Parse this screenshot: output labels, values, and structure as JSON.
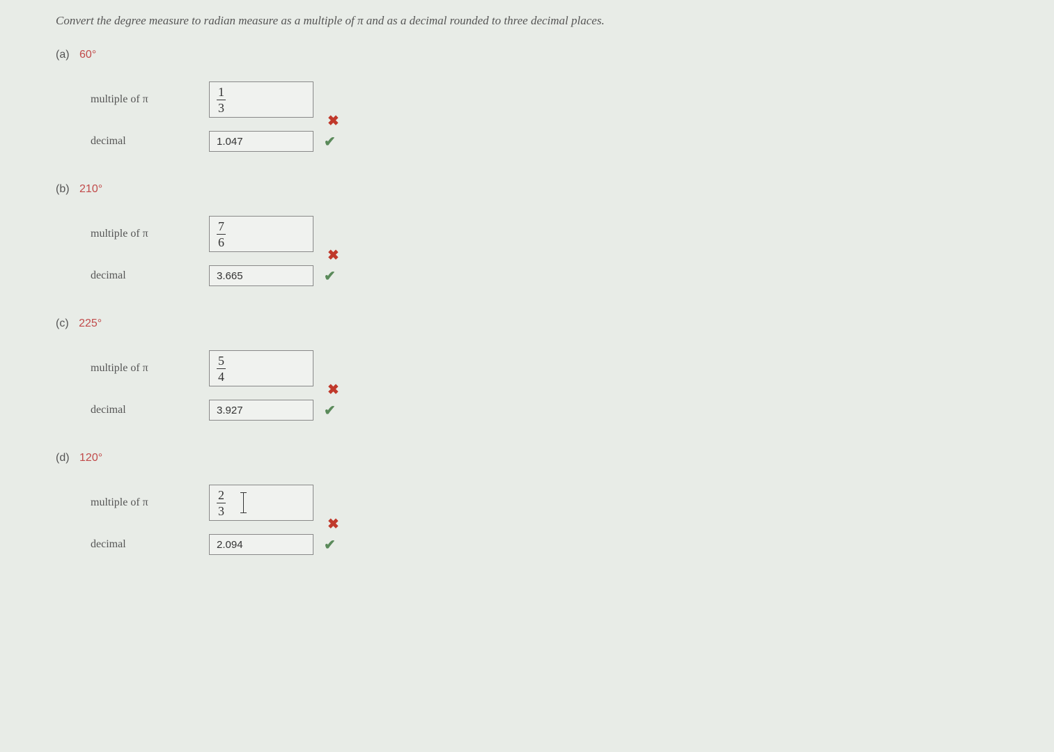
{
  "instruction": "Convert the degree measure to radian measure as a multiple of π and as a decimal rounded to three decimal places.",
  "labels": {
    "multiple": "multiple of π",
    "decimal": "decimal"
  },
  "parts": {
    "a": {
      "letter": "(a)",
      "degree": "60°",
      "frac_num": "1",
      "frac_den": "3",
      "decimal": "1.047"
    },
    "b": {
      "letter": "(b)",
      "degree": "210°",
      "frac_num": "7",
      "frac_den": "6",
      "decimal": "3.665"
    },
    "c": {
      "letter": "(c)",
      "degree": "225°",
      "frac_num": "5",
      "frac_den": "4",
      "decimal": "3.927"
    },
    "d": {
      "letter": "(d)",
      "degree": "120°",
      "frac_num": "2",
      "frac_den": "3",
      "decimal": "2.094"
    }
  },
  "icons": {
    "cross": "✖",
    "check": "✔"
  }
}
